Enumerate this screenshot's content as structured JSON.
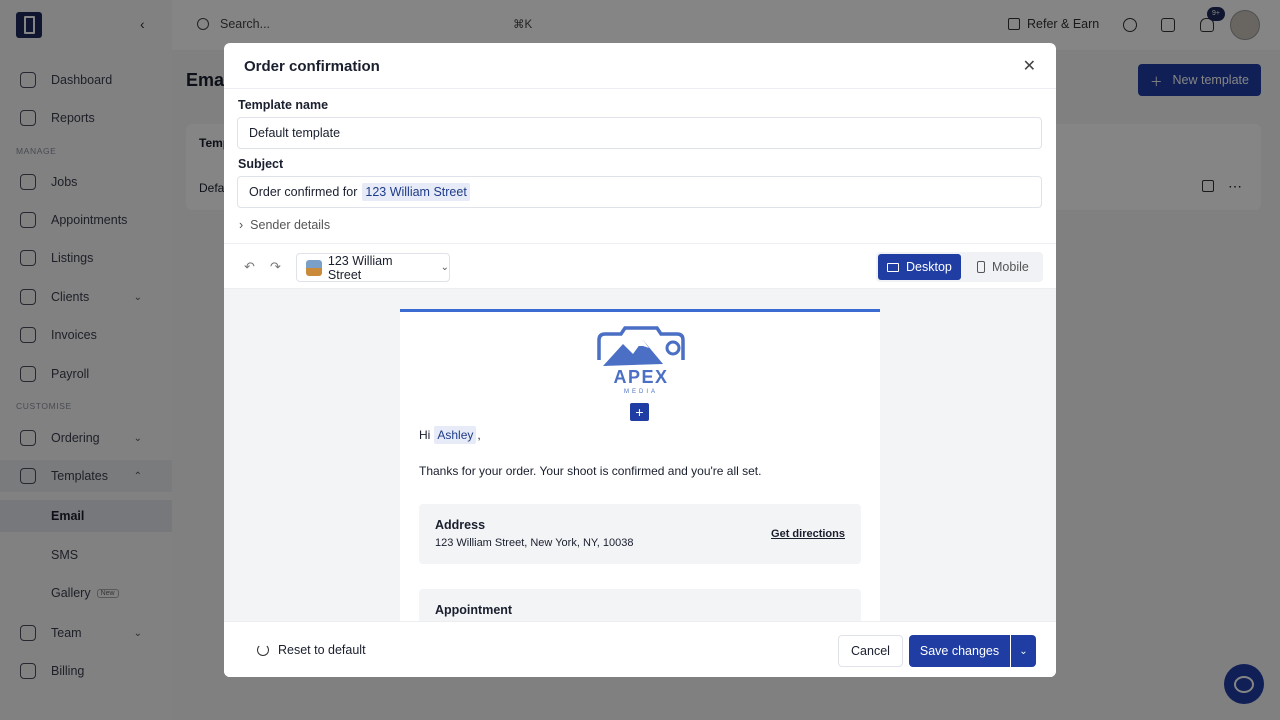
{
  "sidebar": {
    "items": [
      {
        "label": "Dashboard"
      },
      {
        "label": "Reports"
      },
      {
        "label": "Jobs"
      },
      {
        "label": "Appointments"
      },
      {
        "label": "Listings"
      },
      {
        "label": "Clients"
      },
      {
        "label": "Invoices"
      },
      {
        "label": "Payroll"
      },
      {
        "label": "Ordering"
      },
      {
        "label": "Templates"
      },
      {
        "label": "Team"
      },
      {
        "label": "Billing"
      }
    ],
    "sections": [
      "MANAGE",
      "CUSTOMISE"
    ],
    "templates_sub": [
      "Email",
      "SMS",
      "Gallery"
    ],
    "new_tag": "New"
  },
  "topbar": {
    "search_placeholder": "Search...",
    "shortcut": "⌘K",
    "refer_label": "Refer & Earn",
    "notif_count": "9+"
  },
  "page": {
    "title": "Email",
    "new_template_label": "New template",
    "table_header": "Temp",
    "table_row": "Defa"
  },
  "modal": {
    "title": "Order confirmation",
    "template_name_label": "Template name",
    "template_name_value": "Default template",
    "subject_label": "Subject",
    "subject_prefix": "Order confirmed for",
    "subject_tag": "123 William Street",
    "sender_details": "Sender details",
    "property_select": "123 William Street",
    "view_desktop": "Desktop",
    "view_mobile": "Mobile",
    "reset_label": "Reset to default",
    "cancel_label": "Cancel",
    "save_label": "Save changes"
  },
  "email": {
    "brand_name": "APEX",
    "brand_sub": "MEDIA",
    "greeting_hi": "Hi",
    "greeting_name": "Ashley",
    "greeting_comma": ",",
    "body": "Thanks for your order. Your shoot is confirmed and you're all set.",
    "address_title": "Address",
    "address_value": "123 William Street, New York, NY, 10038",
    "directions": "Get directions",
    "appointment_title": "Appointment"
  },
  "colors": {
    "accent": "#1f3da3",
    "email_border": "#3c6bd1",
    "brand_logo": "#4a6fc4"
  }
}
